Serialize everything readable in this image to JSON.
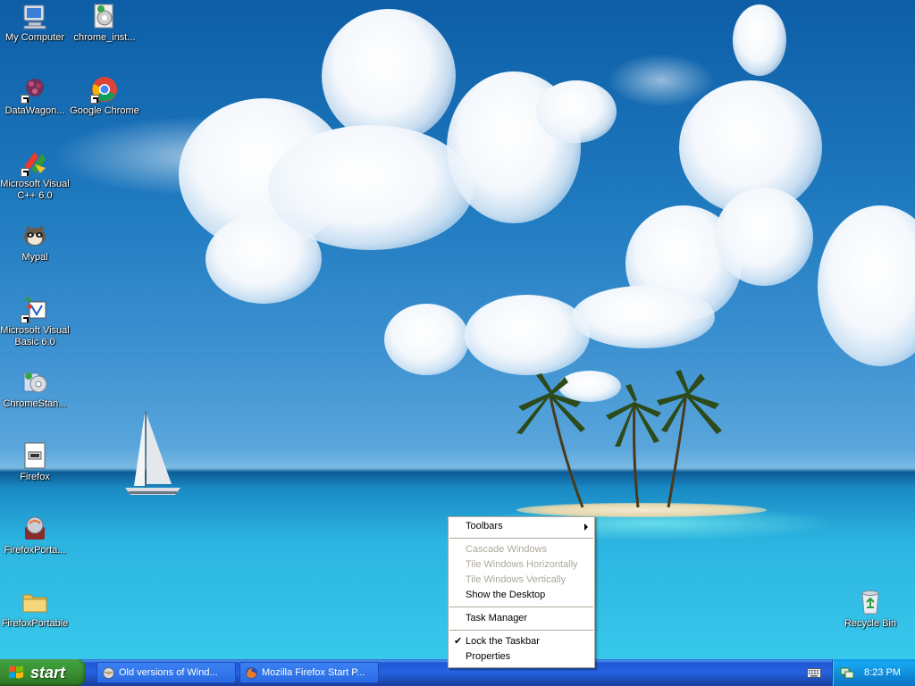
{
  "desktop": {
    "icons": [
      {
        "label": "My Computer",
        "icon": "my-computer-icon"
      },
      {
        "label": "chrome_inst...",
        "icon": "installer-icon"
      },
      {
        "label": "DataWagon...",
        "icon": "datawagon-icon"
      },
      {
        "label": "Google Chrome",
        "icon": "chrome-icon"
      },
      {
        "label": "Microsoft Visual C++ 6.0",
        "icon": "visual-cpp-icon"
      },
      {
        "label": "Mypal",
        "icon": "mypal-icon"
      },
      {
        "label": "Microsoft Visual Basic 6.0",
        "icon": "visual-basic-icon"
      },
      {
        "label": "ChromeStan...",
        "icon": "chrome-standalone-icon"
      },
      {
        "label": "Firefox",
        "icon": "firefox-icon"
      },
      {
        "label": "FirefoxPorta...",
        "icon": "firefox-portable-icon"
      },
      {
        "label": "FirefoxPortable",
        "icon": "folder-icon"
      },
      {
        "label": "Recycle Bin",
        "icon": "recycle-bin-icon"
      }
    ]
  },
  "context_menu": {
    "items": [
      {
        "label": "Toolbars",
        "enabled": true,
        "submenu": true
      },
      {
        "label": "Cascade Windows",
        "enabled": false
      },
      {
        "label": "Tile Windows Horizontally",
        "enabled": false
      },
      {
        "label": "Tile Windows Vertically",
        "enabled": false
      },
      {
        "label": "Show the Desktop",
        "enabled": true
      },
      {
        "label": "Task Manager",
        "enabled": true
      },
      {
        "label": "Lock the Taskbar",
        "enabled": true,
        "checked": true,
        "check_mark": "✔"
      },
      {
        "label": "Properties",
        "enabled": true
      }
    ]
  },
  "taskbar": {
    "start_label": "start",
    "tasks": [
      {
        "label": "Old versions of Wind...",
        "icon": "explorer-window-icon"
      },
      {
        "label": "Mozilla Firefox Start P...",
        "icon": "firefox-icon"
      }
    ],
    "clock": "8:23 PM"
  },
  "colors": {
    "taskbar_blue": "#2663e0",
    "start_green": "#3c8f33",
    "tray_blue": "#0f8ad8",
    "menu_disabled": "#aca899"
  }
}
